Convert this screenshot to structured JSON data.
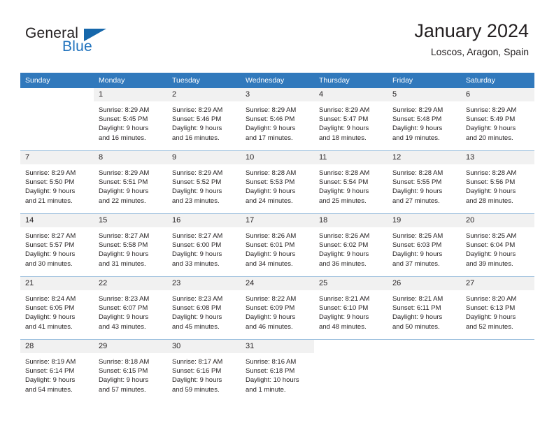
{
  "brand": {
    "name_part1": "General",
    "name_part2": "Blue",
    "triangle_color": "#1667ab",
    "blue_text_color": "#1f72bd"
  },
  "header": {
    "title": "January 2024",
    "subtitle": "Loscos, Aragon, Spain"
  },
  "theme": {
    "header_row_background": "#3179bc",
    "header_row_text": "#ffffff",
    "daynumber_background": "#f1f1f1",
    "grid_line": "#9fc1de",
    "body_text": "#231f20"
  },
  "columns": [
    "Sunday",
    "Monday",
    "Tuesday",
    "Wednesday",
    "Thursday",
    "Friday",
    "Saturday"
  ],
  "weeks": [
    [
      {
        "day": "",
        "sunrise": "",
        "sunset": "",
        "daylight_line1": "",
        "daylight_line2": ""
      },
      {
        "day": "1",
        "sunrise": "Sunrise: 8:29 AM",
        "sunset": "Sunset: 5:45 PM",
        "daylight_line1": "Daylight: 9 hours",
        "daylight_line2": "and 16 minutes."
      },
      {
        "day": "2",
        "sunrise": "Sunrise: 8:29 AM",
        "sunset": "Sunset: 5:46 PM",
        "daylight_line1": "Daylight: 9 hours",
        "daylight_line2": "and 16 minutes."
      },
      {
        "day": "3",
        "sunrise": "Sunrise: 8:29 AM",
        "sunset": "Sunset: 5:46 PM",
        "daylight_line1": "Daylight: 9 hours",
        "daylight_line2": "and 17 minutes."
      },
      {
        "day": "4",
        "sunrise": "Sunrise: 8:29 AM",
        "sunset": "Sunset: 5:47 PM",
        "daylight_line1": "Daylight: 9 hours",
        "daylight_line2": "and 18 minutes."
      },
      {
        "day": "5",
        "sunrise": "Sunrise: 8:29 AM",
        "sunset": "Sunset: 5:48 PM",
        "daylight_line1": "Daylight: 9 hours",
        "daylight_line2": "and 19 minutes."
      },
      {
        "day": "6",
        "sunrise": "Sunrise: 8:29 AM",
        "sunset": "Sunset: 5:49 PM",
        "daylight_line1": "Daylight: 9 hours",
        "daylight_line2": "and 20 minutes."
      }
    ],
    [
      {
        "day": "7",
        "sunrise": "Sunrise: 8:29 AM",
        "sunset": "Sunset: 5:50 PM",
        "daylight_line1": "Daylight: 9 hours",
        "daylight_line2": "and 21 minutes."
      },
      {
        "day": "8",
        "sunrise": "Sunrise: 8:29 AM",
        "sunset": "Sunset: 5:51 PM",
        "daylight_line1": "Daylight: 9 hours",
        "daylight_line2": "and 22 minutes."
      },
      {
        "day": "9",
        "sunrise": "Sunrise: 8:29 AM",
        "sunset": "Sunset: 5:52 PM",
        "daylight_line1": "Daylight: 9 hours",
        "daylight_line2": "and 23 minutes."
      },
      {
        "day": "10",
        "sunrise": "Sunrise: 8:28 AM",
        "sunset": "Sunset: 5:53 PM",
        "daylight_line1": "Daylight: 9 hours",
        "daylight_line2": "and 24 minutes."
      },
      {
        "day": "11",
        "sunrise": "Sunrise: 8:28 AM",
        "sunset": "Sunset: 5:54 PM",
        "daylight_line1": "Daylight: 9 hours",
        "daylight_line2": "and 25 minutes."
      },
      {
        "day": "12",
        "sunrise": "Sunrise: 8:28 AM",
        "sunset": "Sunset: 5:55 PM",
        "daylight_line1": "Daylight: 9 hours",
        "daylight_line2": "and 27 minutes."
      },
      {
        "day": "13",
        "sunrise": "Sunrise: 8:28 AM",
        "sunset": "Sunset: 5:56 PM",
        "daylight_line1": "Daylight: 9 hours",
        "daylight_line2": "and 28 minutes."
      }
    ],
    [
      {
        "day": "14",
        "sunrise": "Sunrise: 8:27 AM",
        "sunset": "Sunset: 5:57 PM",
        "daylight_line1": "Daylight: 9 hours",
        "daylight_line2": "and 30 minutes."
      },
      {
        "day": "15",
        "sunrise": "Sunrise: 8:27 AM",
        "sunset": "Sunset: 5:58 PM",
        "daylight_line1": "Daylight: 9 hours",
        "daylight_line2": "and 31 minutes."
      },
      {
        "day": "16",
        "sunrise": "Sunrise: 8:27 AM",
        "sunset": "Sunset: 6:00 PM",
        "daylight_line1": "Daylight: 9 hours",
        "daylight_line2": "and 33 minutes."
      },
      {
        "day": "17",
        "sunrise": "Sunrise: 8:26 AM",
        "sunset": "Sunset: 6:01 PM",
        "daylight_line1": "Daylight: 9 hours",
        "daylight_line2": "and 34 minutes."
      },
      {
        "day": "18",
        "sunrise": "Sunrise: 8:26 AM",
        "sunset": "Sunset: 6:02 PM",
        "daylight_line1": "Daylight: 9 hours",
        "daylight_line2": "and 36 minutes."
      },
      {
        "day": "19",
        "sunrise": "Sunrise: 8:25 AM",
        "sunset": "Sunset: 6:03 PM",
        "daylight_line1": "Daylight: 9 hours",
        "daylight_line2": "and 37 minutes."
      },
      {
        "day": "20",
        "sunrise": "Sunrise: 8:25 AM",
        "sunset": "Sunset: 6:04 PM",
        "daylight_line1": "Daylight: 9 hours",
        "daylight_line2": "and 39 minutes."
      }
    ],
    [
      {
        "day": "21",
        "sunrise": "Sunrise: 8:24 AM",
        "sunset": "Sunset: 6:05 PM",
        "daylight_line1": "Daylight: 9 hours",
        "daylight_line2": "and 41 minutes."
      },
      {
        "day": "22",
        "sunrise": "Sunrise: 8:23 AM",
        "sunset": "Sunset: 6:07 PM",
        "daylight_line1": "Daylight: 9 hours",
        "daylight_line2": "and 43 minutes."
      },
      {
        "day": "23",
        "sunrise": "Sunrise: 8:23 AM",
        "sunset": "Sunset: 6:08 PM",
        "daylight_line1": "Daylight: 9 hours",
        "daylight_line2": "and 45 minutes."
      },
      {
        "day": "24",
        "sunrise": "Sunrise: 8:22 AM",
        "sunset": "Sunset: 6:09 PM",
        "daylight_line1": "Daylight: 9 hours",
        "daylight_line2": "and 46 minutes."
      },
      {
        "day": "25",
        "sunrise": "Sunrise: 8:21 AM",
        "sunset": "Sunset: 6:10 PM",
        "daylight_line1": "Daylight: 9 hours",
        "daylight_line2": "and 48 minutes."
      },
      {
        "day": "26",
        "sunrise": "Sunrise: 8:21 AM",
        "sunset": "Sunset: 6:11 PM",
        "daylight_line1": "Daylight: 9 hours",
        "daylight_line2": "and 50 minutes."
      },
      {
        "day": "27",
        "sunrise": "Sunrise: 8:20 AM",
        "sunset": "Sunset: 6:13 PM",
        "daylight_line1": "Daylight: 9 hours",
        "daylight_line2": "and 52 minutes."
      }
    ],
    [
      {
        "day": "28",
        "sunrise": "Sunrise: 8:19 AM",
        "sunset": "Sunset: 6:14 PM",
        "daylight_line1": "Daylight: 9 hours",
        "daylight_line2": "and 54 minutes."
      },
      {
        "day": "29",
        "sunrise": "Sunrise: 8:18 AM",
        "sunset": "Sunset: 6:15 PM",
        "daylight_line1": "Daylight: 9 hours",
        "daylight_line2": "and 57 minutes."
      },
      {
        "day": "30",
        "sunrise": "Sunrise: 8:17 AM",
        "sunset": "Sunset: 6:16 PM",
        "daylight_line1": "Daylight: 9 hours",
        "daylight_line2": "and 59 minutes."
      },
      {
        "day": "31",
        "sunrise": "Sunrise: 8:16 AM",
        "sunset": "Sunset: 6:18 PM",
        "daylight_line1": "Daylight: 10 hours",
        "daylight_line2": "and 1 minute."
      },
      {
        "day": "",
        "sunrise": "",
        "sunset": "",
        "daylight_line1": "",
        "daylight_line2": ""
      },
      {
        "day": "",
        "sunrise": "",
        "sunset": "",
        "daylight_line1": "",
        "daylight_line2": ""
      },
      {
        "day": "",
        "sunrise": "",
        "sunset": "",
        "daylight_line1": "",
        "daylight_line2": ""
      }
    ]
  ]
}
